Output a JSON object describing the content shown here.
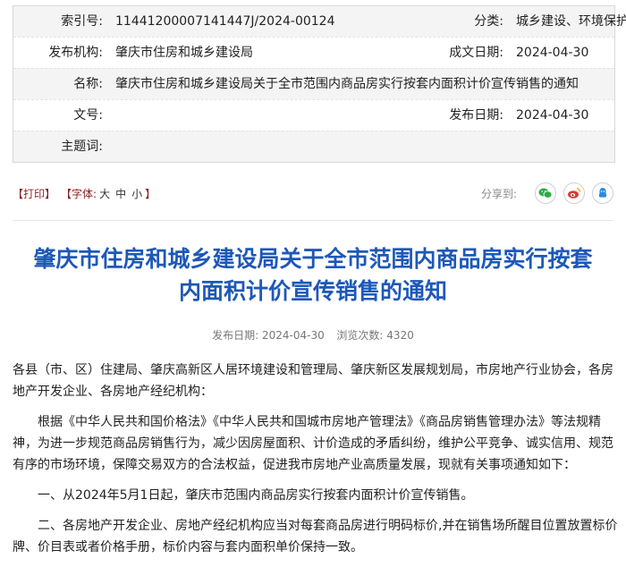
{
  "meta": {
    "index_label": "索引号:",
    "index_value": "11441200007141447J/2024-00124",
    "category_label": "分类:",
    "category_value": "城乡建设、环境保护",
    "publisher_label": "发布机构:",
    "publisher_value": "肇庆市住房和城乡建设局",
    "created_label": "成文日期:",
    "created_value": "2024-04-30",
    "name_label": "名称:",
    "name_value": "肇庆市住房和城乡建设局关于全市范围内商品房实行按套内面积计价宣传销售的通知",
    "docno_label": "文号:",
    "docno_value": "",
    "published_label": "发布日期:",
    "published_value": "2024-04-30",
    "keywords_label": "主题词:",
    "keywords_value": ""
  },
  "tools": {
    "print": "【打印】",
    "font_prefix": "【字体:",
    "font_large": "大",
    "font_medium": "中",
    "font_small": "小",
    "font_suffix": "】",
    "share_label": "分享到:",
    "share_icons": [
      "wechat-icon",
      "weibo-icon",
      "qzone-icon"
    ]
  },
  "article": {
    "title_line1": "肇庆市住房和城乡建设局关于全市范围内商品房实行按套",
    "title_line2": "内面积计价宣传销售的通知",
    "pub_date_label": "发布日期:",
    "pub_date": "2024-04-30",
    "views_label": "浏览次数:",
    "views": "4320",
    "paragraphs": [
      "各县（市、区）住建局、肇庆高新区人居环境建设和管理局、肇庆新区发展规划局，市房地产行业协会，各房地产开发企业、各房地产经纪机构：",
      "根据《中华人民共和国价格法》《中华人民共和国城市房地产管理法》《商品房销售管理办法》等法规精神，为进一步规范商品房销售行为，减少因房屋面积、计价造成的矛盾纠纷，维护公平竞争、诚实信用、规范有序的市场环境，保障交易双方的合法权益，促进我市房地产业高质量发展，现就有关事项通知如下：",
      "一、从2024年5月1日起，肇庆市范围内商品房实行按套内面积计价宣传销售。",
      "二、各房地产开发企业、房地产经纪机构应当对每套商品房进行明码标价,并在销售场所醒目位置放置标价牌、价目表或者价格手册，标价内容与套内面积单价保持一致。"
    ]
  },
  "colors": {
    "title": "#1d58b8",
    "bracket": "#8b1d1d",
    "wechat": "#2aae43",
    "weibo": "#e2372c",
    "qzone": "#2d8ce0"
  }
}
